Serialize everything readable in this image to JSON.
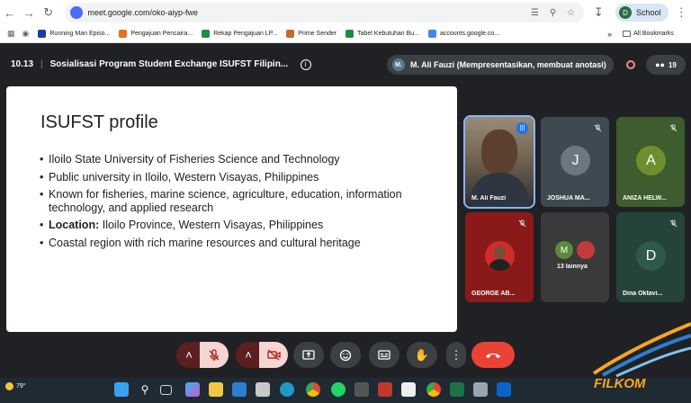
{
  "browser": {
    "url": "meet.google.com/oko-aiyp-fwe",
    "profile_label": "School",
    "profile_initial": "D",
    "bookmarks": [
      {
        "label": "Running Man Episo...",
        "color": "#1a3ea8"
      },
      {
        "label": "Pengajuan Pencaira...",
        "color": "#e86e22"
      },
      {
        "label": "Rekap Pengajuan LP...",
        "color": "#1e8e3e"
      },
      {
        "label": "Prime Sender",
        "color": "#c26b2a"
      },
      {
        "label": "Tabel Kebutuhan Bu...",
        "color": "#1e8e3e"
      },
      {
        "label": "accounts.google.co...",
        "color": "#4285f4"
      }
    ],
    "all_bookmarks_label": "All Bookmarks"
  },
  "meet": {
    "time": "10.13",
    "separator": "|",
    "title": "Sosialisasi Program Student Exchange ISUFST Filipin...",
    "presenter_initial": "M.",
    "presenter_label": "M. Ali Fauzi (Mempresentasikan, membuat anotasi)",
    "participant_count": "19"
  },
  "slide": {
    "title": "ISUFST profile",
    "bullets": [
      {
        "bold": "",
        "text": "Iloilo State University of Fisheries Science and Technology"
      },
      {
        "bold": "",
        "text": "Public university in Iloilo, Western Visayas, Philippines"
      },
      {
        "bold": "",
        "text": "Known for fisheries, marine science, agriculture, education, information technology, and applied research"
      },
      {
        "bold": "Location:",
        "text": " Iloilo Province, Western Visayas, Philippines"
      },
      {
        "bold": "",
        "text": "Coastal region with rich marine resources and cultural heritage"
      }
    ]
  },
  "tiles": [
    {
      "name": "M. Ali Fauzi",
      "type": "video",
      "bg": "#7a6a5a"
    },
    {
      "name": "JOSHUA MA...",
      "initial": "J",
      "bg": "#3d4a52",
      "avatar_bg": "#6b7880"
    },
    {
      "name": "ANIZA HELW...",
      "initial": "A",
      "bg": "#3e5c2e",
      "avatar_bg": "#6e8f2e"
    },
    {
      "name": "GEORGE AB...",
      "type": "photo",
      "bg": "#8a1a1a"
    },
    {
      "name": "13 lainnya",
      "initial": "M",
      "bg": "#3a3a3a",
      "avatar_bg": "#5a8a3a"
    },
    {
      "name": "Dina Oktavi...",
      "initial": "D",
      "bg": "#25433a",
      "avatar_bg": "#2e5a4a"
    }
  ],
  "taskbar": {
    "temperature": "79°"
  },
  "watermark": "FILKOM"
}
